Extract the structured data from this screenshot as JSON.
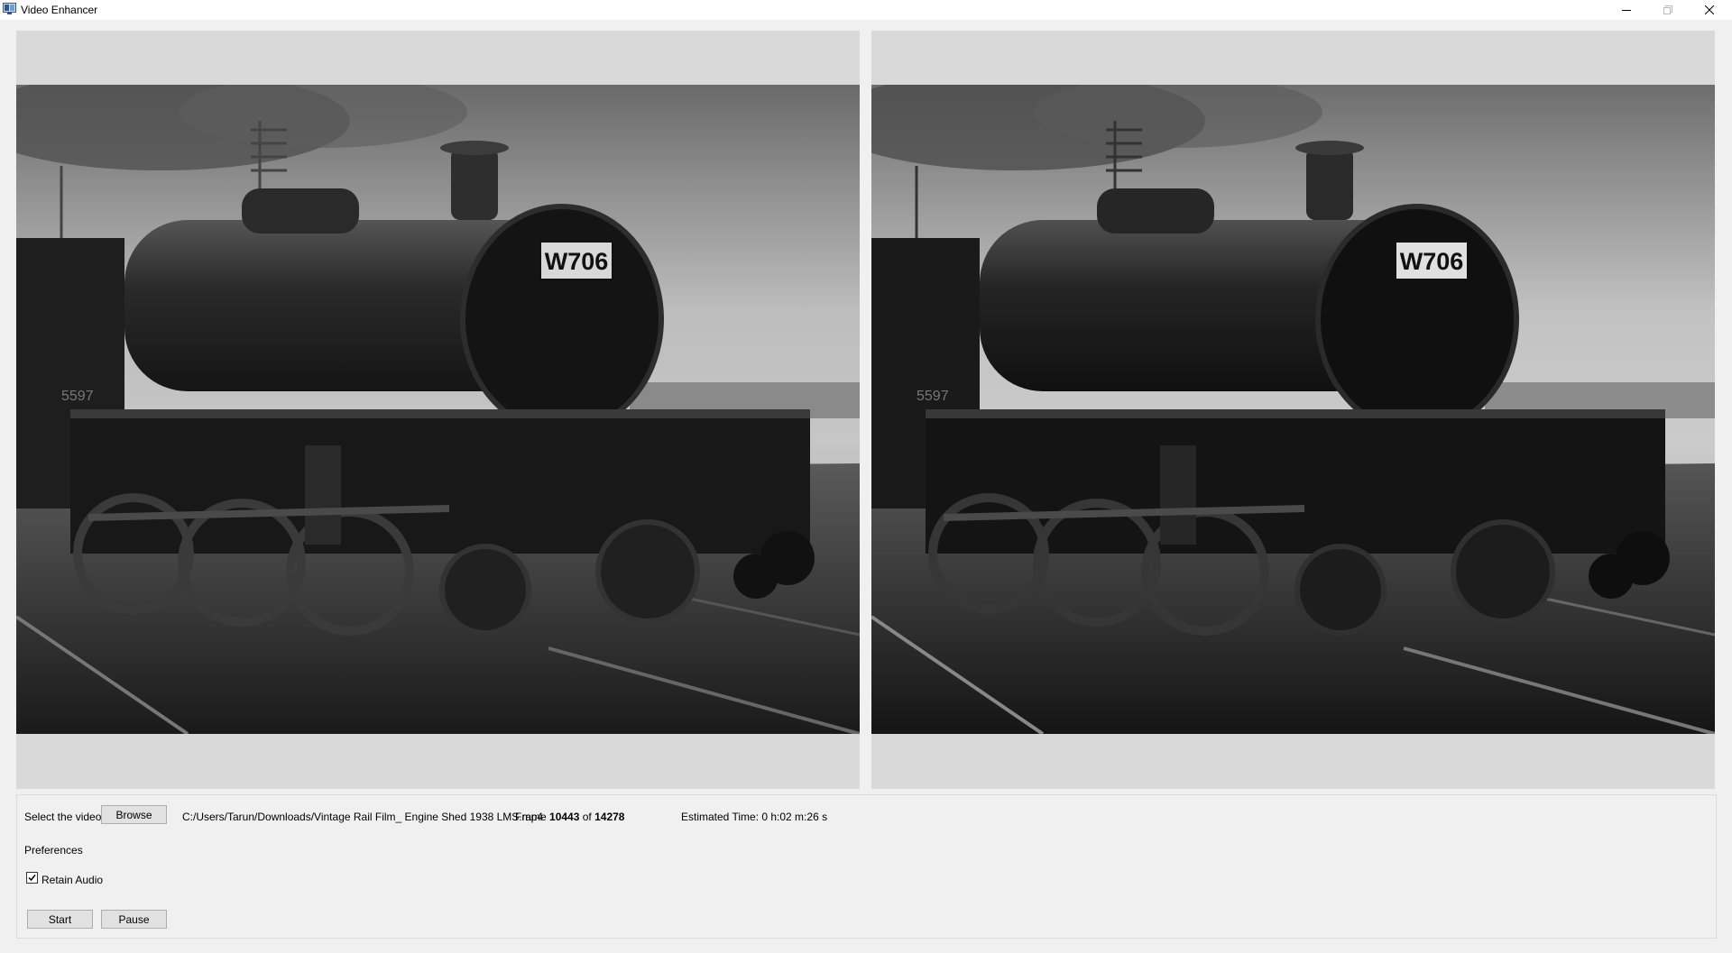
{
  "window": {
    "title": "Video Enhancer",
    "icons": [
      "app-icon",
      "minimize-icon",
      "restore-icon",
      "close-icon"
    ]
  },
  "viewer": {
    "left_frame": "original-video-frame",
    "right_frame": "enhanced-video-frame",
    "plate_text": "W706",
    "engine_number": "5597"
  },
  "controls": {
    "select_label": "Select the video",
    "browse_label": "Browse",
    "file_path": "C:/Users/Tarun/Downloads/Vintage Rail Film_ Engine Shed 1938 LMS.mp4",
    "frame_prefix": "Frame",
    "frame_current": "10443",
    "frame_of": "of",
    "frame_total": "14278",
    "estimated_time": "Estimated Time: 0 h:02 m:26 s",
    "preferences_label": "Preferences",
    "retain_audio_label": "Retain Audio",
    "retain_audio_checked": true,
    "start_label": "Start",
    "pause_label": "Pause"
  }
}
